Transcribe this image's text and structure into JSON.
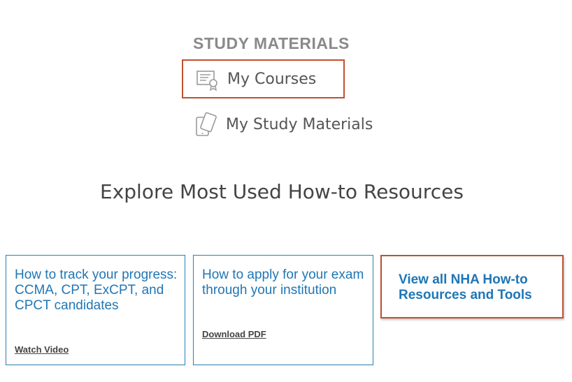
{
  "study_section": {
    "heading": "STUDY MATERIALS",
    "links": [
      {
        "label": "My Courses",
        "icon": "certificate-icon"
      },
      {
        "label": "My Study Materials",
        "icon": "tablet-icon"
      }
    ]
  },
  "resources": {
    "heading": "Explore Most Used How-to Resources",
    "cards": [
      {
        "title": "How to track your progress: CCMA, CPT, ExCPT, and CPCT candidates",
        "link": "Watch Video"
      },
      {
        "title": "How to apply for your exam through your institution",
        "link": "Download PDF"
      }
    ],
    "view_all": "View all NHA How-to Resources and Tools"
  },
  "colors": {
    "highlight_border": "#c0502f",
    "link_blue": "#1f76b5",
    "card_border": "#2a7eb3",
    "heading_gray": "#8a8a8a"
  }
}
